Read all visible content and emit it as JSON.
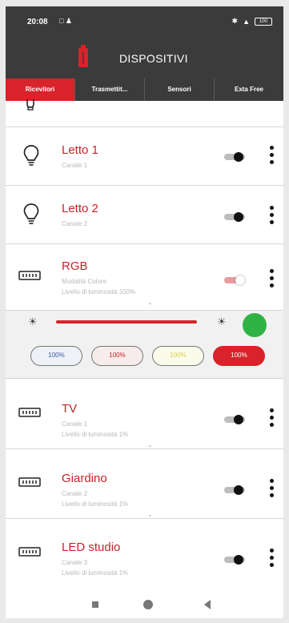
{
  "status_bar": {
    "time": "20:08",
    "battery": "100"
  },
  "app_bar": {
    "title": "DISPOSITIVI"
  },
  "tabs": [
    {
      "label": "Ricevitori",
      "active": true
    },
    {
      "label": "Trasmettit...",
      "active": false
    },
    {
      "label": "Sensori",
      "active": false
    },
    {
      "label": "Exta Free",
      "active": false
    }
  ],
  "devices": [
    {
      "name": "Letto 1",
      "line1": "Canale 1",
      "line2": "",
      "icon": "bulb-icon",
      "on": false
    },
    {
      "name": "Letto 2",
      "line1": "Canale 2",
      "line2": "",
      "icon": "bulb-icon",
      "on": false
    },
    {
      "name": "RGB",
      "line1": "Modalità Colore",
      "line2": "Livello di luminosità 100%",
      "icon": "led-controller-icon",
      "on": true
    },
    {
      "name": "TV",
      "line1": "Canale 1",
      "line2": "Livello di luminosità 1%",
      "icon": "led-controller-icon",
      "on": false
    },
    {
      "name": "Giardino",
      "line1": "Canale 2",
      "line2": "Livello di luminosità 1%",
      "icon": "led-controller-icon",
      "on": false
    },
    {
      "name": "LED studio",
      "line1": "Canale 3",
      "line2": "Livello di luminosità 1%",
      "icon": "led-controller-icon",
      "on": false
    }
  ],
  "rgb_panel": {
    "brightness_percent": 100,
    "color": "#2fb344",
    "presets": [
      {
        "label": "100%",
        "color": "#3a5aa8"
      },
      {
        "label": "100%",
        "color": "#c8222a"
      },
      {
        "label": "100%",
        "color": "#d6d24a"
      },
      {
        "label": "100%",
        "color": "#ffffff"
      }
    ]
  },
  "colors": {
    "accent": "#d8232a",
    "header_bg": "#3b3b3b",
    "device_name": "#c8222a"
  }
}
